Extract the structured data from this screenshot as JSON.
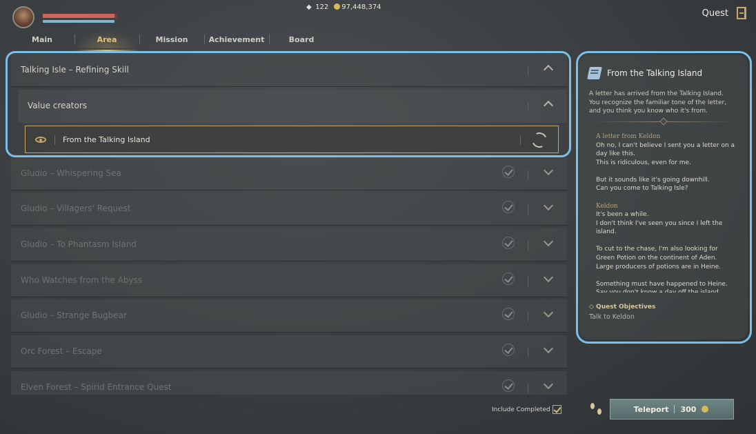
{
  "header": {
    "gems": "122",
    "adena": "97,448,374",
    "title": "Quest"
  },
  "tabs": [
    {
      "label": "Main",
      "active": false
    },
    {
      "label": "Area",
      "active": true
    },
    {
      "label": "Mission",
      "active": false
    },
    {
      "label": "Achievement",
      "active": false
    },
    {
      "label": "Board",
      "active": false
    }
  ],
  "list": {
    "expanded_group": "Talking Isle – Refining Skill",
    "expanded_sub": "Value creators",
    "selected_quest": "From the Talking Island",
    "completed_groups": [
      "Gludio – Whispering Sea",
      "Gludio – Villagers' Request",
      "Gludio – To Phantasm Island",
      "Who Watches from the Abyss",
      "Gludio – Strange Bugbear",
      "Orc Forest – Escape",
      "Elven Forest – Spirid Entrance Quest"
    ]
  },
  "detail": {
    "title": "From the Talking Island",
    "intro": "A letter has arrived from the Talking Island. You recognize the familiar tone of the letter, and you think you know who it's from.",
    "letter": [
      {
        "speaker": "A letter from Keldon",
        "text": "Oh no, I can't believe I sent you a letter on a day like this.\nThis is ridiculous, even for me."
      },
      {
        "speaker": "",
        "text": "But it sounds like it's going downhill.\nCan you come to Talking Isle?"
      },
      {
        "speaker": "Keldon",
        "text": "It's been a while.\nI don't think I've seen you since I left the island."
      },
      {
        "speaker": "",
        "text": "To cut to the chase, I'm also looking for Green Potion on the continent of Aden.\nLarge producers of potions are in Heine."
      },
      {
        "speaker": "",
        "text": "Something must have happened to Heine.\nSay you don't know a day off the island"
      }
    ],
    "objectives_title": "◇ Quest Objectives",
    "objective": "Talk to Keldon"
  },
  "footer": {
    "include_completed": "Include Completed",
    "teleport_label": "Teleport",
    "teleport_cost": "300"
  },
  "colors": {
    "accent_gold": "#c8a868",
    "highlight": "#7cc0e8",
    "teleport": "#607776"
  }
}
